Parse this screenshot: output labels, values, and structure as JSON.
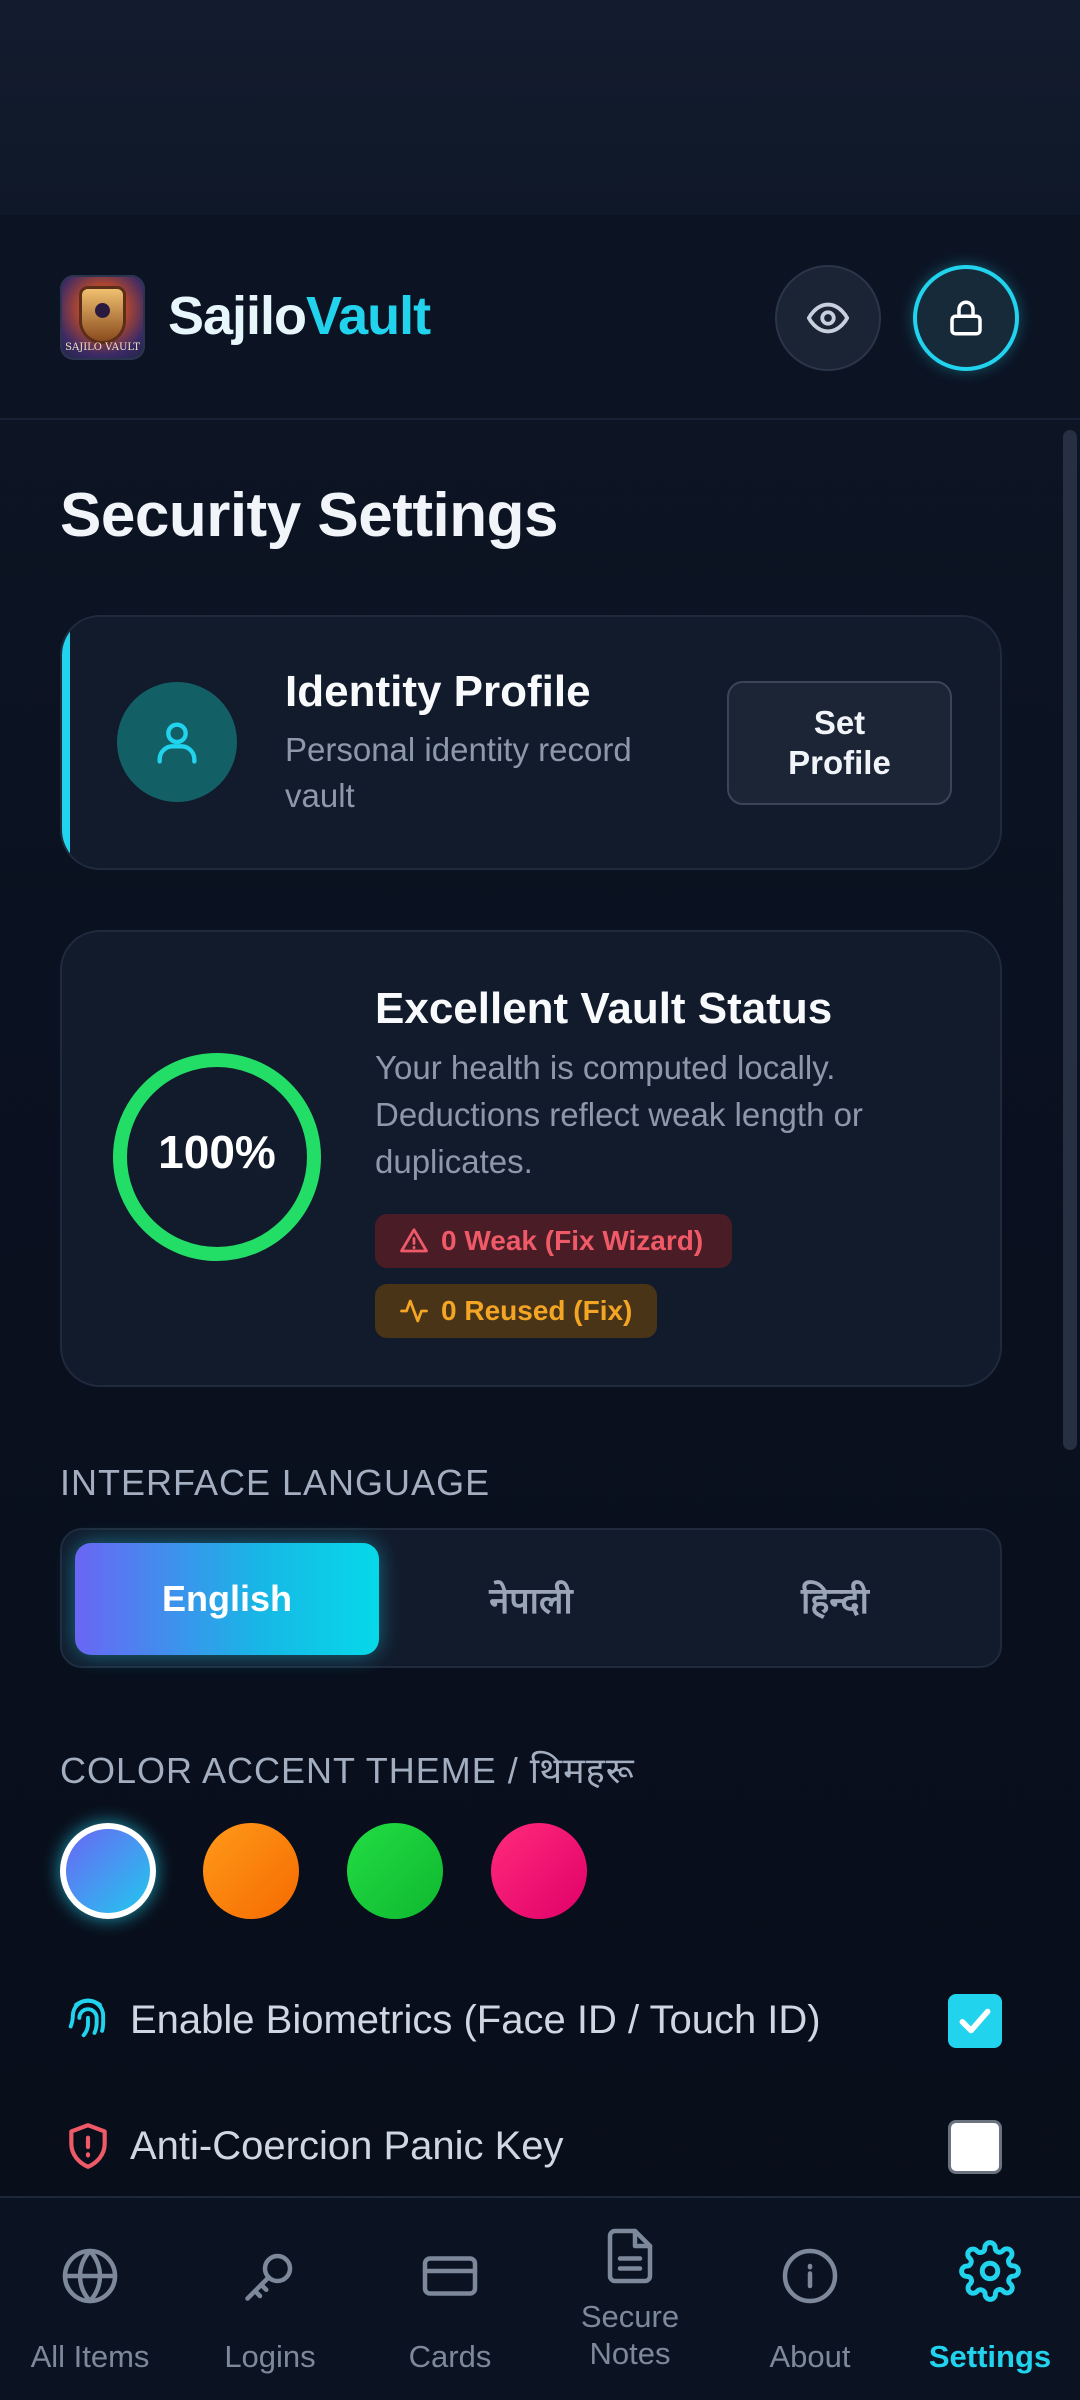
{
  "app": {
    "brand_part1": "Sajilo",
    "brand_part2": "Vault",
    "logo_text": "SAJILO VAULT"
  },
  "header": {
    "privacy_toggle_icon": "eye-icon",
    "lock_icon": "lock-icon"
  },
  "page": {
    "title": "Security Settings"
  },
  "identity_card": {
    "title": "Identity Profile",
    "subtitle": "Personal identity record vault",
    "button_label": "Set Profile",
    "icon": "user-icon"
  },
  "vault_status": {
    "score_label": "100%",
    "score_fraction": 1.0,
    "title": "Excellent Vault Status",
    "description": "Your health is computed locally. Deductions reflect weak length or duplicates.",
    "weak_chip": "0 Weak (Fix Wizard)",
    "reused_chip": "0 Reused (Fix)"
  },
  "language": {
    "section_label": "INTERFACE LANGUAGE",
    "options": [
      "English",
      "नेपाली",
      "हिन्दी"
    ],
    "selected": "English"
  },
  "theme": {
    "section_label": "COLOR ACCENT THEME / थिमहरू",
    "swatches": [
      "#22c8ee",
      "#ff8a0d",
      "#1ccc3a",
      "#f0146f"
    ],
    "selected_index": 0
  },
  "toggles": {
    "biometrics": {
      "label": "Enable Biometrics (Face ID / Touch ID)",
      "checked": true
    },
    "panic_key": {
      "label": "Anti-Coercion Panic Key",
      "checked": false
    }
  },
  "bottom_nav": {
    "items": [
      {
        "label": "All Items",
        "icon": "globe-icon"
      },
      {
        "label": "Logins",
        "icon": "key-icon"
      },
      {
        "label": "Cards",
        "icon": "card-icon"
      },
      {
        "label": "Secure Notes",
        "icon": "document-icon"
      },
      {
        "label": "About",
        "icon": "info-icon"
      },
      {
        "label": "Settings",
        "icon": "gear-icon"
      }
    ],
    "active": "Settings"
  },
  "colors": {
    "accent": "#22d3ee",
    "success": "#22dd66",
    "danger": "#f05a68",
    "warning": "#f5a524"
  }
}
